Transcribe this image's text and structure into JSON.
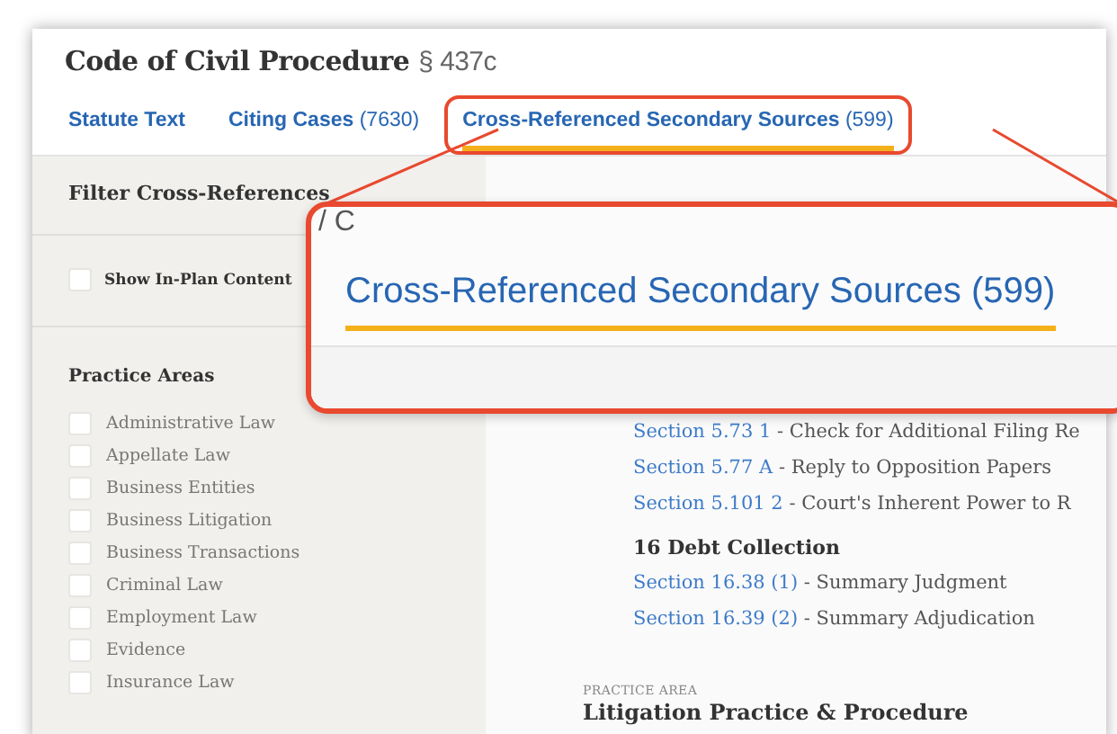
{
  "header": {
    "title": "Code of Civil Procedure",
    "section": "§ 437c"
  },
  "tabs": [
    {
      "label": "Statute Text",
      "selected": false,
      "highlighted": false
    },
    {
      "label": "Citing Cases",
      "count": "(7630)",
      "selected": false,
      "highlighted": false
    },
    {
      "label": "Cross-Referenced Secondary Sources",
      "count": "(599)",
      "selected": true,
      "highlighted": true
    }
  ],
  "sidebar": {
    "heading": "Filter Cross-References",
    "in_plan": {
      "label": "Show In-Plan Content",
      "checked": false
    },
    "practice_areas": {
      "heading": "Practice Areas",
      "items": [
        {
          "label": "Administrative Law",
          "checked": false
        },
        {
          "label": "Appellate Law",
          "checked": false
        },
        {
          "label": "Business Entities",
          "checked": false
        },
        {
          "label": "Business Litigation",
          "checked": false
        },
        {
          "label": "Business Transactions",
          "checked": false
        },
        {
          "label": "Criminal Law",
          "checked": false
        },
        {
          "label": "Employment Law",
          "checked": false
        },
        {
          "label": "Evidence",
          "checked": false
        },
        {
          "label": "Insurance Law",
          "checked": false
        }
      ]
    }
  },
  "results": {
    "groups": [
      {
        "links": [
          {
            "section": "Section 5.73 1",
            "title": "- Check for Additional Filing Re"
          },
          {
            "section": "Section 5.77 A",
            "title": "- Reply to Opposition Papers"
          },
          {
            "section": "Section 5.101 2",
            "title": "- Court's Inherent Power to R"
          }
        ]
      },
      {
        "heading": "16 Debt Collection",
        "links": [
          {
            "section": "Section 16.38 (1)",
            "title": "- Summary Judgment"
          },
          {
            "section": "Section 16.39 (2)",
            "title": "- Summary Adjudication"
          }
        ]
      }
    ],
    "practice_area_label": "PRACTICE AREA",
    "practice_area_title": "Litigation Practice & Procedure"
  },
  "callout": {
    "fragment": "/ C",
    "tab": {
      "label": "Cross-Referenced Secondary Sources",
      "count": "(599)",
      "selected": true
    }
  }
}
